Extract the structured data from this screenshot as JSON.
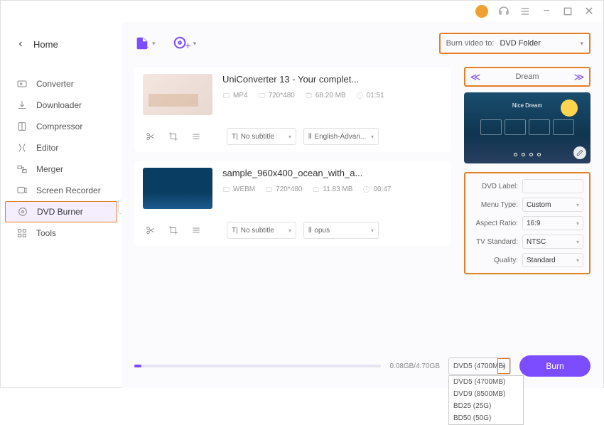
{
  "titlebar": {
    "user": "user",
    "headset": "support",
    "menu": "menu",
    "min": "−",
    "max": "□",
    "close": "✕"
  },
  "home": {
    "label": "Home"
  },
  "nav": {
    "items": [
      {
        "label": "Converter"
      },
      {
        "label": "Downloader"
      },
      {
        "label": "Compressor"
      },
      {
        "label": "Editor"
      },
      {
        "label": "Merger"
      },
      {
        "label": "Screen Recorder"
      },
      {
        "label": "DVD Burner"
      },
      {
        "label": "Tools"
      }
    ]
  },
  "burn_to": {
    "label": "Burn video to:",
    "value": "DVD Folder"
  },
  "videos": [
    {
      "title": "UniConverter 13 - Your complet...",
      "format": "MP4",
      "resolution": "720*480",
      "size": "68.20 MB",
      "duration": "01:51",
      "subtitle": "No subtitle",
      "audio": "English-Advan..."
    },
    {
      "title": "sample_960x400_ocean_with_a...",
      "format": "WEBM",
      "resolution": "720*480",
      "size": "11.83 MB",
      "duration": "00:47",
      "subtitle": "No subtitle",
      "audio": "opus"
    }
  ],
  "template": {
    "name": "Dream",
    "preview_title": "Nice Dream"
  },
  "settings": {
    "dvd_label": {
      "label": "DVD Label:",
      "value": ""
    },
    "menu_type": {
      "label": "Menu Type:",
      "value": "Custom"
    },
    "aspect": {
      "label": "Aspect Ratio:",
      "value": "16:9"
    },
    "tv": {
      "label": "TV Standard:",
      "value": "NTSC"
    },
    "quality": {
      "label": "Quality:",
      "value": "Standard"
    }
  },
  "bottom": {
    "progress": "0.08GB/4.70GB",
    "disc_selected": "DVD5 (4700MB)",
    "disc_options": [
      "DVD5 (4700MB)",
      "DVD9 (8500MB)",
      "BD25 (25G)",
      "BD50 (50G)"
    ],
    "burn": "Burn"
  }
}
